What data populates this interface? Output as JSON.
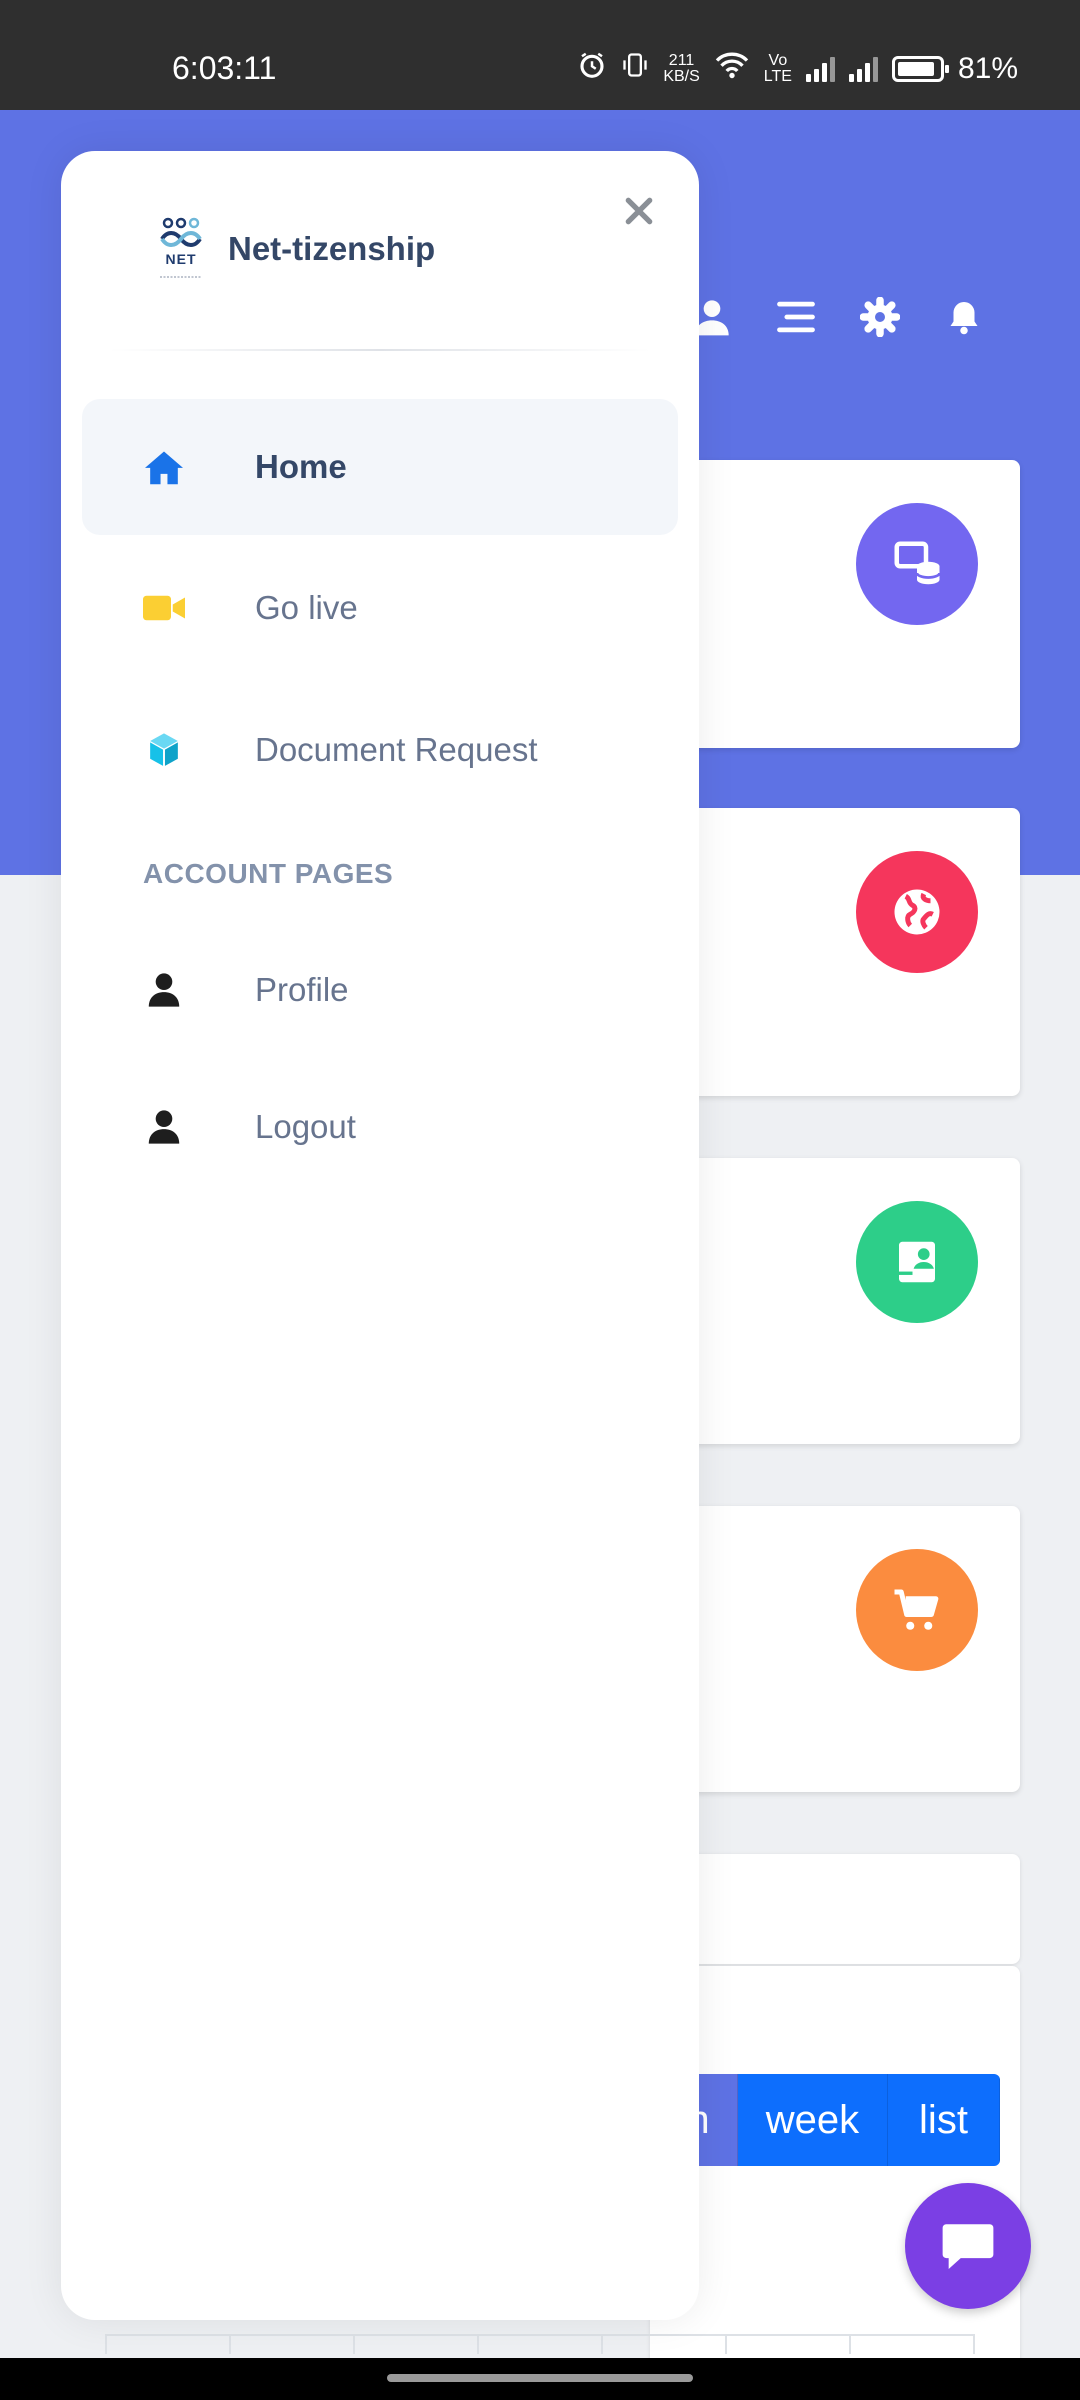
{
  "status_bar": {
    "time": "6:03:11",
    "net_speed_value": "211",
    "net_speed_unit": "KB/S",
    "volte_top": "Vo",
    "volte_bottom": "LTE",
    "battery": "81%"
  },
  "sidebar": {
    "brand": "Net-tizenship",
    "logo_text": "NET",
    "items": [
      {
        "label": "Home",
        "icon": "home-icon",
        "active": true
      },
      {
        "label": "Go live",
        "icon": "video-camera-icon"
      },
      {
        "label": "Document Request",
        "icon": "cube-icon"
      }
    ],
    "section_title": "ACCOUNT PAGES",
    "account_items": [
      {
        "label": "Profile",
        "icon": "user-icon"
      },
      {
        "label": "Logout",
        "icon": "user-icon"
      }
    ]
  },
  "calendar": {
    "view_buttons": [
      "n",
      "week",
      "list"
    ]
  },
  "colors": {
    "hero": "#5e72e4",
    "home_icon": "#1a73e8",
    "video_icon": "#fbcf33",
    "cube_icon": "#17c1e8",
    "stat1": "#7367f0",
    "stat2": "#f5365c",
    "stat3": "#2dce89",
    "stat4": "#fb8c3f",
    "chat": "#7b3fe4"
  }
}
